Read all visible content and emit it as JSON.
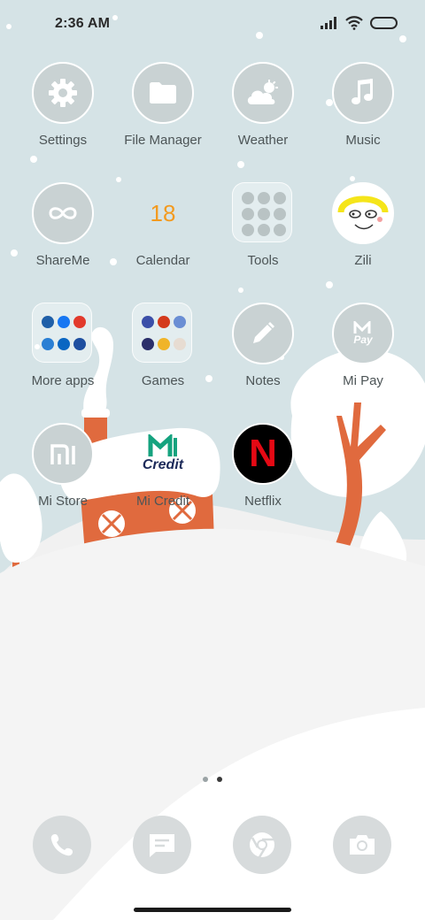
{
  "status_bar": {
    "time": "2:36 AM"
  },
  "apps": [
    {
      "name": "settings",
      "label": "Settings",
      "icon": "gear-icon"
    },
    {
      "name": "file-manager",
      "label": "File Manager",
      "icon": "folder-icon"
    },
    {
      "name": "weather",
      "label": "Weather",
      "icon": "cloud-sun-icon"
    },
    {
      "name": "music",
      "label": "Music",
      "icon": "music-note-icon"
    },
    {
      "name": "shareme",
      "label": "ShareMe",
      "icon": "infinity-icon"
    },
    {
      "name": "calendar",
      "label": "Calendar",
      "icon": "calendar-icon",
      "date": "18"
    },
    {
      "name": "tools",
      "label": "Tools",
      "icon": "tools-folder-icon"
    },
    {
      "name": "zili",
      "label": "Zili",
      "icon": "zili-face-icon"
    },
    {
      "name": "more-apps",
      "label": "More apps",
      "icon": "more-apps-folder-icon"
    },
    {
      "name": "games",
      "label": "Games",
      "icon": "games-folder-icon"
    },
    {
      "name": "notes",
      "label": "Notes",
      "icon": "pencil-icon"
    },
    {
      "name": "mi-pay",
      "label": "Mi Pay",
      "icon": "mi-pay-icon",
      "logo_text": "Pay"
    },
    {
      "name": "mi-store",
      "label": "Mi Store",
      "icon": "mi-logo-icon"
    },
    {
      "name": "mi-credit",
      "label": "Mi Credit",
      "icon": "mi-credit-icon",
      "logo_text": "Credit"
    },
    {
      "name": "netflix",
      "label": "Netflix",
      "icon": "netflix-icon",
      "logo_text": "N"
    }
  ],
  "dock": [
    {
      "name": "phone",
      "icon": "phone-icon"
    },
    {
      "name": "messages",
      "icon": "message-icon"
    },
    {
      "name": "browser",
      "icon": "browser-icon"
    },
    {
      "name": "camera",
      "icon": "camera-icon"
    }
  ],
  "pager": {
    "pages": 2,
    "active_index": 1
  },
  "colors": {
    "sky": "#d5e3e6",
    "snow": "#f4f4f4",
    "house": "#e06a3e",
    "tree": "#e06a3e",
    "calendar_date": "#f39a1e",
    "netflix_red": "#e50914"
  }
}
